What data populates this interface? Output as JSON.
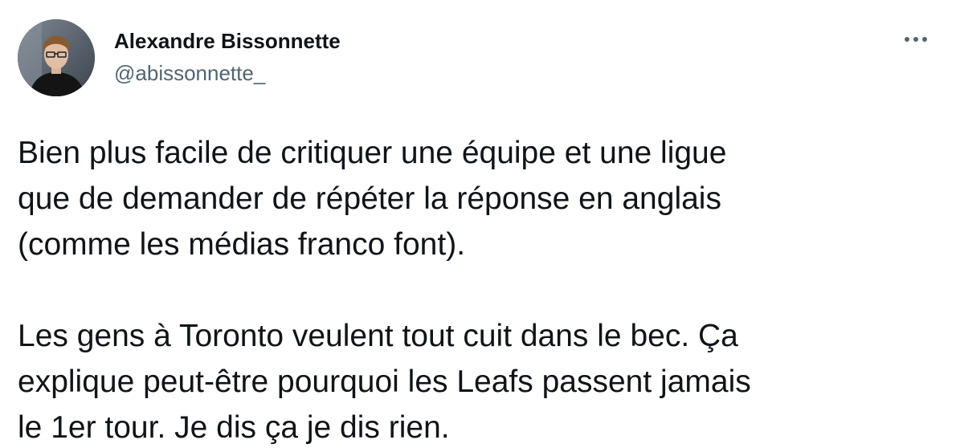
{
  "author": {
    "display_name": "Alexandre Bissonnette",
    "handle": "@abissonnette_"
  },
  "more_icon": "more-horizontal-icon",
  "tweet": {
    "paragraphs": [
      {
        "lines": [
          "Bien plus facile de critiquer une équipe et une ligue",
          "que de demander de répéter la réponse en anglais",
          "(comme les médias franco font)."
        ]
      },
      {
        "lines": [
          "Les gens à Toronto veulent tout cuit dans le bec. Ça",
          "explique peut-être pourquoi les Leafs passent jamais",
          "le 1er tour. Je dis ça je dis rien."
        ]
      }
    ]
  },
  "colors": {
    "text_primary": "#0f1419",
    "text_secondary": "#536471",
    "background": "#ffffff"
  }
}
